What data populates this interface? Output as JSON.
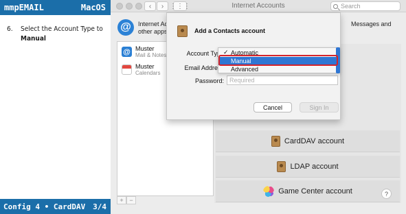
{
  "doc": {
    "brand": "mmpEMAIL",
    "os": "MacOS",
    "step_number": "6.",
    "step_text": "Select the Account Type to",
    "step_bold": "Manual",
    "footer_left": "Config 4 • CardDAV",
    "footer_page": "3/4"
  },
  "window": {
    "title": "Internet Accounts",
    "search_placeholder": "Search",
    "header_text_line1": "Internet Ac",
    "header_text_line2": "other apps",
    "header_text_right": "Messages and"
  },
  "accounts": [
    {
      "name": "Muster",
      "sub": "Mail & Notes",
      "icon": "at-icon"
    },
    {
      "name": "Muster",
      "sub": "Calendars",
      "icon": "calendar-icon"
    }
  ],
  "providers": {
    "carddav": "CardDAV account",
    "ldap": "LDAP account",
    "gamecenter": "Game Center account"
  },
  "dialog": {
    "title": "Add a Contacts account",
    "account_type_label": "Account Type",
    "email_label": "Email Address",
    "password_label": "Password:",
    "password_placeholder": "Required",
    "cancel": "Cancel",
    "sign_in": "Sign In"
  },
  "popup": {
    "options": [
      "Automatic",
      "Manual",
      "Advanced"
    ],
    "checked": "Automatic",
    "highlighted": "Manual"
  },
  "colors": {
    "doc_bar": "#1b6ea9",
    "selection": "#2f76d3",
    "callout": "#d4232a"
  }
}
